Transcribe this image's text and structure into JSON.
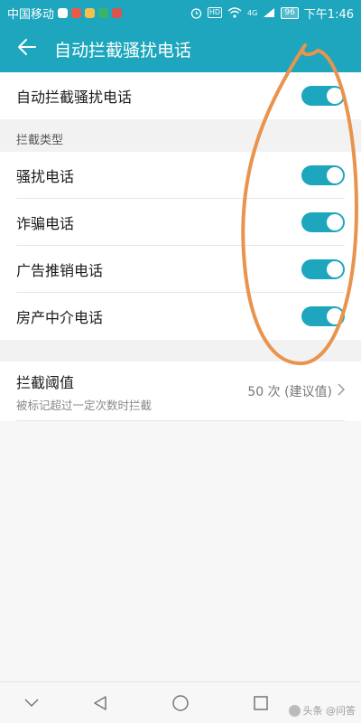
{
  "status_bar": {
    "carrier": "中国移动",
    "hd": "HD",
    "signal": "4G",
    "battery": "96",
    "time": "下午1:46"
  },
  "toolbar": {
    "title": "自动拦截骚扰电话",
    "back_icon": "arrow-left-icon"
  },
  "master_toggle": {
    "label": "自动拦截骚扰电话",
    "on": true
  },
  "intercept_types": {
    "header": "拦截类型",
    "items": [
      {
        "label": "骚扰电话",
        "on": true
      },
      {
        "label": "诈骗电话",
        "on": true
      },
      {
        "label": "广告推销电话",
        "on": true
      },
      {
        "label": "房产中介电话",
        "on": true
      }
    ]
  },
  "threshold": {
    "title": "拦截阈值",
    "subtitle": "被标记超过一定次数时拦截",
    "value": "50 次 (建议值)"
  },
  "nav": {
    "icons": [
      "chevron-down-icon",
      "back-triangle-icon",
      "home-circle-icon",
      "recents-square-icon"
    ]
  },
  "watermark": "头条 @问答",
  "colors": {
    "accent": "#1da6bd",
    "annotation": "#e8944e"
  }
}
